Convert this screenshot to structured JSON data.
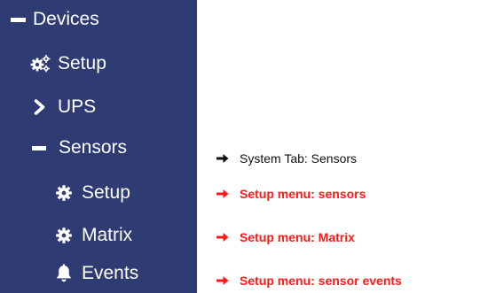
{
  "sidebar": {
    "background": "#2f3c73",
    "devices": {
      "label": "Devices",
      "icon": "minus-icon"
    },
    "devices_setup": {
      "label": "Setup",
      "icon": "gears-icon"
    },
    "ups": {
      "label": "UPS",
      "icon": "chevron-right-icon"
    },
    "sensors": {
      "label": "Sensors",
      "icon": "minus-icon"
    },
    "sensors_setup": {
      "label": "Setup",
      "icon": "gear-icon"
    },
    "matrix": {
      "label": "Matrix",
      "icon": "gear-icon"
    },
    "events": {
      "label": "Events",
      "icon": "bell-icon"
    }
  },
  "annotations": {
    "system_tab": {
      "text": "System Tab: Sensors",
      "color": "#111111"
    },
    "setup_sensors": {
      "text": "Setup menu: sensors",
      "color": "#ff1a1a"
    },
    "setup_matrix": {
      "text": "Setup menu: Matrix",
      "color": "#ff1a1a"
    },
    "sensor_events": {
      "text": "Setup menu: sensor events",
      "color": "#ff1a1a"
    }
  }
}
